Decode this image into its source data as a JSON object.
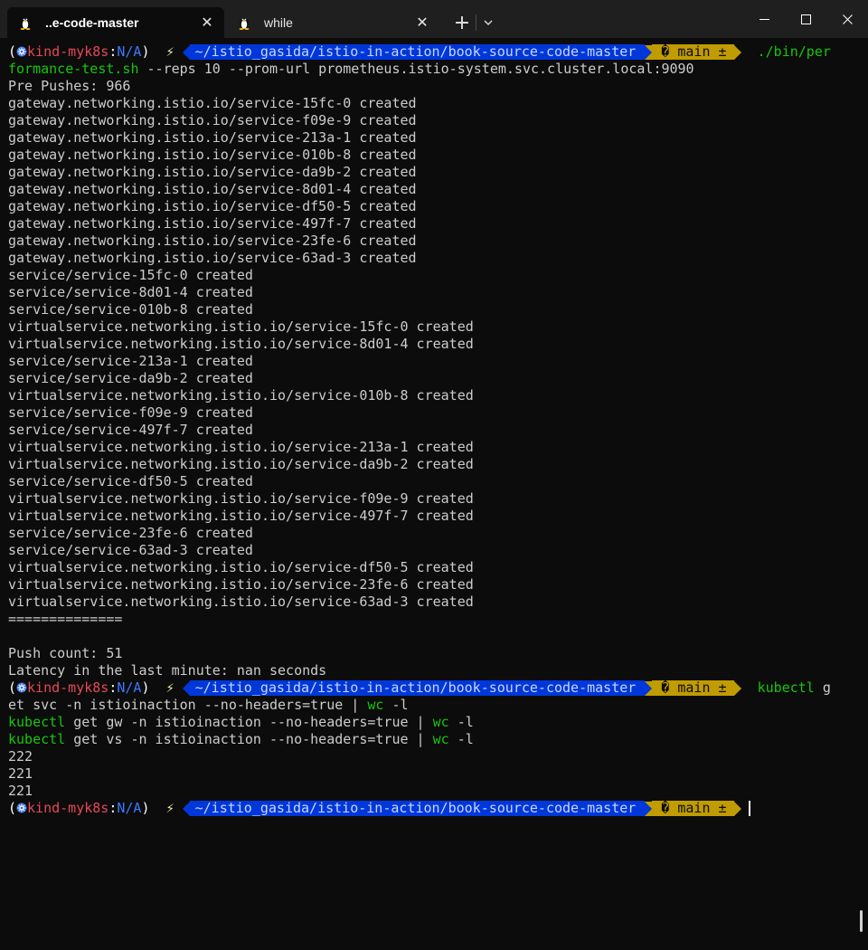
{
  "tabs": [
    {
      "label": "..e-code-master",
      "icon": "linux-penguin-icon",
      "close": "✕"
    },
    {
      "label": "while",
      "icon": "linux-penguin-icon",
      "close": "✕"
    }
  ],
  "titlebar": {
    "new_tab": "+",
    "dropdown": "⌄"
  },
  "prompt": {
    "open": "(",
    "context": "kind-myk8s",
    "sep": ":",
    "namespace": "N/A",
    "close": ")",
    "bolt": "⚡",
    "path": "~/istio_gasida/istio-in-action/book-source-code-master",
    "git": "� main ±"
  },
  "cmd1": {
    "part1": "./bin/per",
    "part2_green": "formance-test.sh",
    "part2_rest": " --reps 10 --prom-url prometheus.istio-system.svc.cluster.local:9090"
  },
  "output1": [
    "Pre Pushes: 966",
    "gateway.networking.istio.io/service-15fc-0 created",
    "gateway.networking.istio.io/service-f09e-9 created",
    "gateway.networking.istio.io/service-213a-1 created",
    "gateway.networking.istio.io/service-010b-8 created",
    "gateway.networking.istio.io/service-da9b-2 created",
    "gateway.networking.istio.io/service-8d01-4 created",
    "gateway.networking.istio.io/service-df50-5 created",
    "gateway.networking.istio.io/service-497f-7 created",
    "gateway.networking.istio.io/service-23fe-6 created",
    "gateway.networking.istio.io/service-63ad-3 created",
    "service/service-15fc-0 created",
    "service/service-8d01-4 created",
    "service/service-010b-8 created",
    "virtualservice.networking.istio.io/service-15fc-0 created",
    "virtualservice.networking.istio.io/service-8d01-4 created",
    "service/service-213a-1 created",
    "service/service-da9b-2 created",
    "virtualservice.networking.istio.io/service-010b-8 created",
    "service/service-f09e-9 created",
    "service/service-497f-7 created",
    "virtualservice.networking.istio.io/service-213a-1 created",
    "virtualservice.networking.istio.io/service-da9b-2 created",
    "service/service-df50-5 created",
    "virtualservice.networking.istio.io/service-f09e-9 created",
    "virtualservice.networking.istio.io/service-497f-7 created",
    "service/service-23fe-6 created",
    "service/service-63ad-3 created",
    "virtualservice.networking.istio.io/service-df50-5 created",
    "virtualservice.networking.istio.io/service-23fe-6 created",
    "virtualservice.networking.istio.io/service-63ad-3 created",
    "==============",
    "",
    "Push count: 51",
    "Latency in the last minute: nan seconds"
  ],
  "cmd2": {
    "line1_cmd": "kubectl",
    "line1_rest": " g",
    "line2_a": "et svc -n istioinaction --no-headers=true | ",
    "line2_wc": "wc",
    "line2_b": " -l",
    "line3_cmd": "kubectl",
    "line3_a": " get gw -n istioinaction --no-headers=true | ",
    "line3_wc": "wc",
    "line3_b": " -l",
    "line4_cmd": "kubectl",
    "line4_a": " get vs -n istioinaction --no-headers=true | ",
    "line4_wc": "wc",
    "line4_b": " -l"
  },
  "output2": [
    "222",
    "221",
    "221"
  ],
  "colors": {
    "background": "#0c0c0c",
    "path_segment": "#0037da",
    "git_segment": "#c19c00",
    "command_green": "#16c60c",
    "context_red": "#e74856"
  }
}
